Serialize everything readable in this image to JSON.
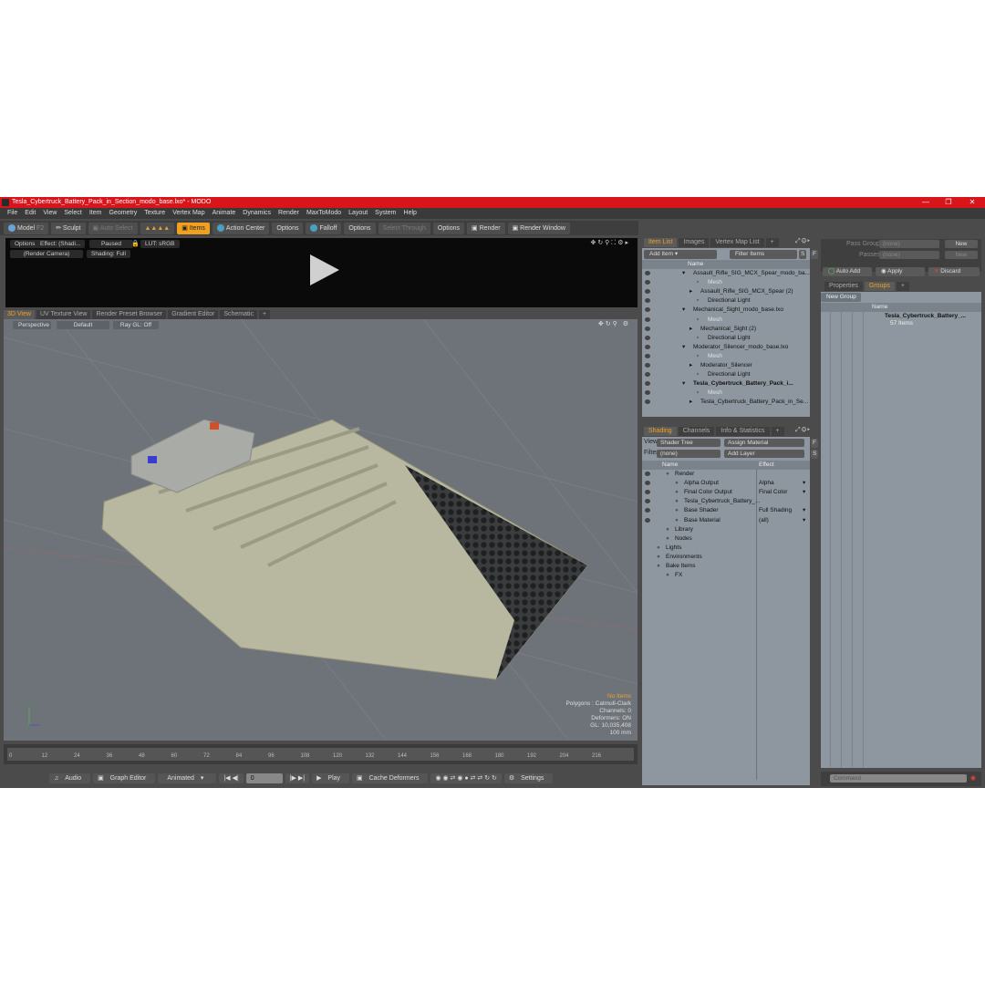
{
  "window": {
    "title": "Tesla_Cybertruck_Battery_Pack_in_Section_modo_base.lxo* - MODO"
  },
  "menu": [
    "File",
    "Edit",
    "View",
    "Select",
    "Item",
    "Geometry",
    "Texture",
    "Vertex Map",
    "Animate",
    "Dynamics",
    "Render",
    "MaxToModo",
    "Layout",
    "System",
    "Help"
  ],
  "toolbar": {
    "model": "Model",
    "f2": "F2",
    "sculpt": "Sculpt",
    "auto_select": "Auto Select",
    "items": "Items",
    "action_center": "Action Center",
    "options1": "Options",
    "falloff": "Falloff",
    "options2": "Options",
    "select_through": "Select Through",
    "options3": "Options",
    "render": "Render",
    "render_window": "Render Window"
  },
  "preview": {
    "options": "Options",
    "effect": "Effect: (Shadi...",
    "paused": "Paused",
    "lut": "LUT: sRGB",
    "camera": "(Render Camera)",
    "shading": "Shading: Full"
  },
  "viewport_tabs": [
    "3D View",
    "UV Texture View",
    "Render Preset Browser",
    "Gradient Editor",
    "Schematic",
    "+"
  ],
  "viewport": {
    "perspective": "Perspective",
    "default": "Default",
    "raygl": "Ray GL: Off",
    "info": {
      "no_items": "No Items",
      "polygons": "Polygons : Catmull-Clark",
      "channels": "Channels: 0",
      "deformers": "Deformers: ON",
      "gl": "GL: 10,035,408",
      "scale": "100 mm"
    }
  },
  "timeline": {
    "ticks": [
      "0",
      "12",
      "24",
      "36",
      "48",
      "60",
      "72",
      "84",
      "96",
      "108",
      "120",
      "132",
      "144",
      "156",
      "168",
      "180",
      "192",
      "204",
      "216"
    ],
    "marker_start": "225",
    "marker_end": "225"
  },
  "transport": {
    "audio": "Audio",
    "graph_editor": "Graph Editor",
    "animated": "Animated",
    "frame": "0",
    "play": "Play",
    "cache_deformers": "Cache Deformers",
    "settings": "Settings"
  },
  "item_list": {
    "tabs": [
      "Item List",
      "Images",
      "Vertex Map List",
      "+"
    ],
    "add_item": "Add Item",
    "filter_items": "Filter Items",
    "s": "S",
    "f": "F",
    "header": "Name",
    "rows": [
      {
        "label": "Assault_Rifle_SIG_MCX_Spear_modo_ba...",
        "indent": 0,
        "bold": false,
        "grey": false
      },
      {
        "label": "Mesh",
        "indent": 2,
        "bold": false,
        "grey": true
      },
      {
        "label": "Assault_Rifle_SIG_MCX_Spear (2)",
        "indent": 1,
        "bold": false,
        "grey": false
      },
      {
        "label": "Directional Light",
        "indent": 2,
        "bold": false,
        "grey": false
      },
      {
        "label": "Mechanical_Sight_modo_base.lxo",
        "indent": 0,
        "bold": false,
        "grey": false
      },
      {
        "label": "Mesh",
        "indent": 2,
        "bold": false,
        "grey": true
      },
      {
        "label": "Mechanical_Sight (2)",
        "indent": 1,
        "bold": false,
        "grey": false
      },
      {
        "label": "Directional Light",
        "indent": 2,
        "bold": false,
        "grey": false
      },
      {
        "label": "Moderator_Silencer_modo_base.lxo",
        "indent": 0,
        "bold": false,
        "grey": false
      },
      {
        "label": "Mesh",
        "indent": 2,
        "bold": false,
        "grey": true
      },
      {
        "label": "Moderator_Silencer",
        "indent": 1,
        "bold": false,
        "grey": false
      },
      {
        "label": "Directional Light",
        "indent": 2,
        "bold": false,
        "grey": false
      },
      {
        "label": "Tesla_Cybertruck_Battery_Pack_i...",
        "indent": 0,
        "bold": true,
        "grey": false
      },
      {
        "label": "Mesh",
        "indent": 2,
        "bold": false,
        "grey": true
      },
      {
        "label": "Tesla_Cybertruck_Battery_Pack_in_Se...",
        "indent": 1,
        "bold": false,
        "grey": false
      }
    ]
  },
  "shading": {
    "tabs": [
      "Shading",
      "Channels",
      "Info & Statistics",
      "+"
    ],
    "view_label": "View",
    "view_value": "Shader Tree",
    "assign_material": "Assign Material",
    "filter_label": "Filter",
    "filter_value": "(none)",
    "add_layer": "Add Layer",
    "f": "F",
    "s": "S",
    "header_name": "Name",
    "header_effect": "Effect",
    "rows": [
      {
        "label": "Render",
        "effect": "",
        "indent": 1
      },
      {
        "label": "Alpha Output",
        "effect": "Alpha",
        "indent": 2
      },
      {
        "label": "Final Color Output",
        "effect": "Final Color",
        "indent": 2
      },
      {
        "label": "Tesla_Cybertruck_Battery_...",
        "effect": "",
        "indent": 2
      },
      {
        "label": "Base Shader",
        "effect": "Full Shading",
        "indent": 2
      },
      {
        "label": "Base Material",
        "effect": "(all)",
        "indent": 2
      },
      {
        "label": "Library",
        "effect": "",
        "indent": 1
      },
      {
        "label": "Nodes",
        "effect": "",
        "indent": 1
      },
      {
        "label": "Lights",
        "effect": "",
        "indent": 0
      },
      {
        "label": "Environments",
        "effect": "",
        "indent": 0
      },
      {
        "label": "Bake Items",
        "effect": "",
        "indent": 0
      },
      {
        "label": "FX",
        "effect": "",
        "indent": 1
      }
    ]
  },
  "right": {
    "pass_groups": "Pass Groups",
    "pass_groups_value": "(none)",
    "passes": "Passes",
    "passes_value": "(none)",
    "new1": "New",
    "new2": "New",
    "auto_add": "Auto Add",
    "apply": "Apply",
    "discard": "Discard",
    "tabs": [
      "Properties",
      "Groups",
      "+"
    ],
    "new_group": "New Group",
    "header_name": "Name",
    "group_name": "Tesla_Cybertruck_Battery_...",
    "group_items": "57 Items",
    "command": "Command"
  }
}
